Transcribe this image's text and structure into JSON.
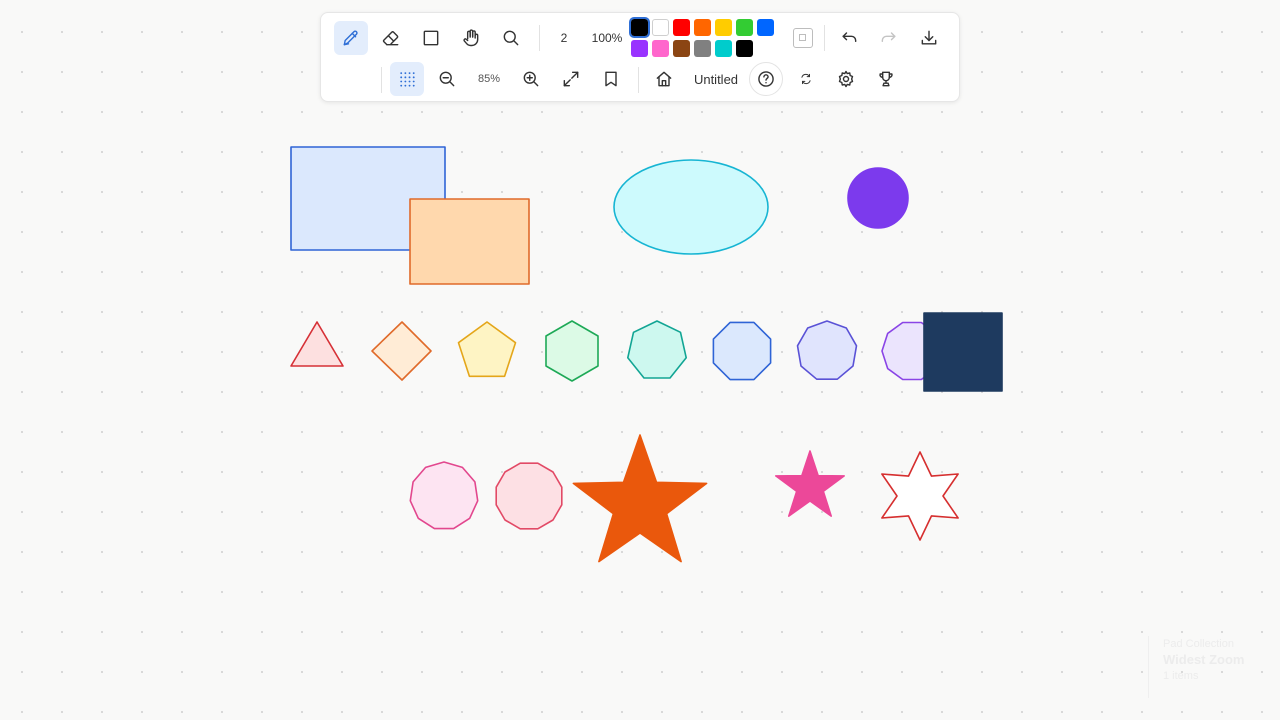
{
  "toolbar": {
    "stroke_width": "2",
    "opacity": "100%",
    "zoom": "85%",
    "document_title": "Untitled",
    "tools": [
      {
        "name": "pencil-tool",
        "icon": "pencil-icon",
        "active": true
      },
      {
        "name": "eraser-tool",
        "icon": "eraser-icon"
      },
      {
        "name": "rectangle-tool",
        "icon": "square-icon"
      },
      {
        "name": "pan-tool",
        "icon": "hand-icon"
      },
      {
        "name": "search-tool",
        "icon": "search-icon"
      }
    ],
    "palette": [
      {
        "name": "black",
        "color": "#000000",
        "selected": true
      },
      {
        "name": "white",
        "color": "#ffffff"
      },
      {
        "name": "red",
        "color": "#ff0000"
      },
      {
        "name": "orange",
        "color": "#ff6600"
      },
      {
        "name": "yellow",
        "color": "#ffcc00"
      },
      {
        "name": "green",
        "color": "#33cc33"
      },
      {
        "name": "blue",
        "color": "#0066ff"
      },
      {
        "name": "purple",
        "color": "#9933ff"
      },
      {
        "name": "pink",
        "color": "#ff66cc"
      },
      {
        "name": "brown",
        "color": "#8b4513"
      },
      {
        "name": "gray",
        "color": "#808080"
      },
      {
        "name": "cyan",
        "color": "#00cccc"
      },
      {
        "name": "black-2",
        "color": "#000000"
      }
    ]
  },
  "watermark": {
    "line1": "Pad Collection",
    "line2": "Widest Zoom",
    "line3": "1 items"
  },
  "canvas": {
    "shapes": [
      {
        "name": "blue-rectangle",
        "type": "rectangle",
        "stroke": "#2f64d6",
        "fill": "#dbe8fd"
      },
      {
        "name": "orange-rectangle",
        "type": "rectangle",
        "stroke": "#e06a2a",
        "fill": "#ffd8ad"
      },
      {
        "name": "cyan-ellipse",
        "type": "ellipse",
        "stroke": "#17b5d3",
        "fill": "#cdfafd"
      },
      {
        "name": "purple-circle",
        "type": "circle",
        "stroke": "#7c3aed",
        "fill": "#7c3aed"
      },
      {
        "name": "red-triangle",
        "type": "triangle",
        "stroke": "#d63036",
        "fill": "#fde0e0"
      },
      {
        "name": "orange-diamond",
        "type": "diamond",
        "stroke": "#e06a2a",
        "fill": "#ffecd6"
      },
      {
        "name": "yellow-pentagon",
        "type": "pentagon",
        "stroke": "#e4a61a",
        "fill": "#fef4c4"
      },
      {
        "name": "green-hexagon",
        "type": "hexagon",
        "stroke": "#1ea957",
        "fill": "#dcfae6"
      },
      {
        "name": "teal-heptagon",
        "type": "heptagon",
        "stroke": "#12a594",
        "fill": "#cdf8ef"
      },
      {
        "name": "blue-octagon",
        "type": "octagon",
        "stroke": "#2f64d6",
        "fill": "#dbe8fd"
      },
      {
        "name": "indigo-nonagon",
        "type": "nonagon",
        "stroke": "#5a52d6",
        "fill": "#e0e4fd"
      },
      {
        "name": "violet-decagon",
        "type": "decagon",
        "stroke": "#8a44e6",
        "fill": "#ebe4fd"
      },
      {
        "name": "navy-square",
        "type": "square",
        "stroke": "#1e3a5f",
        "fill": "#1e3a5f"
      },
      {
        "name": "pink-hendecagon",
        "type": "hendecagon",
        "stroke": "#e2478e",
        "fill": "#fde4f2"
      },
      {
        "name": "rose-dodecagon",
        "type": "dodecagon",
        "stroke": "#e24a66",
        "fill": "#fde0e4"
      },
      {
        "name": "orange-star",
        "type": "star-5",
        "stroke": "#ea580c",
        "fill": "#ea580c"
      },
      {
        "name": "pink-star",
        "type": "star-5",
        "stroke": "#ec4899",
        "fill": "#ec4899"
      },
      {
        "name": "red-six-point-star",
        "type": "star-6",
        "stroke": "#d62f2f",
        "fill": "#ffffff"
      }
    ]
  }
}
